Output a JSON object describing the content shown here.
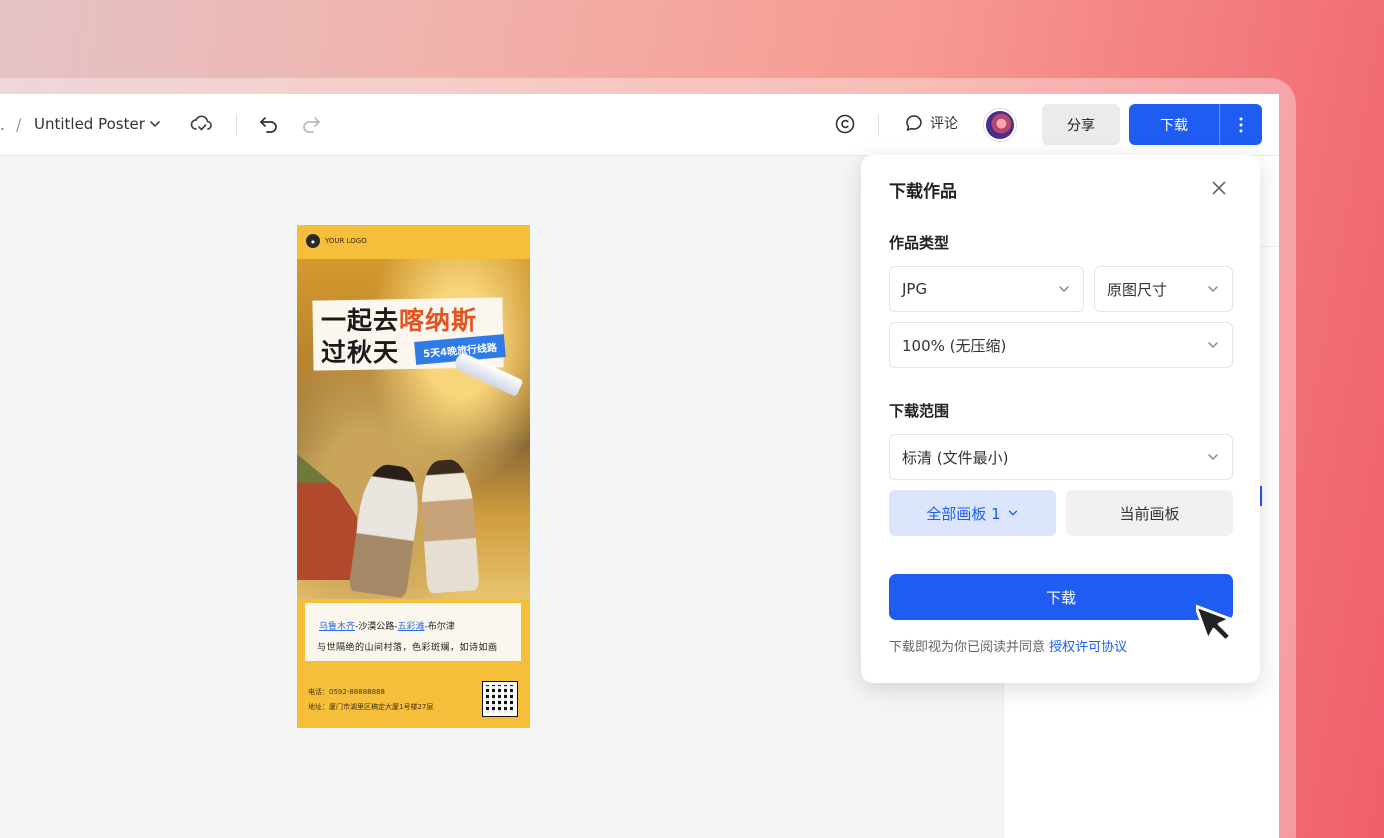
{
  "toolbar": {
    "breadcrumb_prefix": ".",
    "breadcrumb_sep": "/",
    "doc_title": "Untitled Poster",
    "comment_label": "评论",
    "share_label": "分享",
    "download_label": "下载"
  },
  "poster": {
    "logo_text": "YOUR LOGO",
    "title_line1_a": "一起去",
    "title_line1_b": "喀纳斯",
    "title_line2": "过秋天",
    "tag": "5天4晚旅行线路",
    "route_a": "乌鲁木齐",
    "route_b": "-沙漠公路-",
    "route_c": "五彩滩",
    "route_d": "-布尔津",
    "caption_line2": "与世隔绝的山间村落，色彩斑斓，如诗如画",
    "phone": "电话：0592-88888888",
    "address": "地址：厦门市湖里区稿定大厦1号楼27层"
  },
  "download_panel": {
    "title": "下载作品",
    "type_label": "作品类型",
    "format_value": "JPG",
    "size_value": "原图尺寸",
    "quality_value": "100% (无压缩)",
    "range_label": "下载范围",
    "resolution_value": "标清 (文件最小)",
    "all_boards_label": "全部画板 1",
    "current_board_label": "当前画板",
    "download_button": "下载",
    "agreement_text": "下载即视为你已阅读并同意",
    "agreement_link": "授权许可协议"
  },
  "colors": {
    "primary": "#1f5cf1",
    "poster_yellow": "#f6bf3b",
    "accent_orange": "#e5541f"
  }
}
